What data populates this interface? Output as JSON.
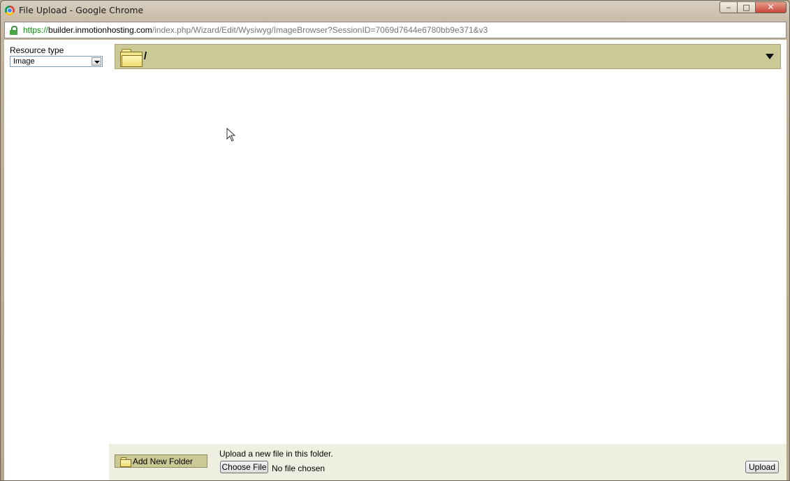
{
  "window": {
    "title": "File Upload - Google Chrome",
    "controls": {
      "minimize": "minimize-icon",
      "maximize": "maximize-icon",
      "close": "close-icon"
    }
  },
  "address": {
    "scheme": "https://",
    "host": "builder.inmotionhosting.com",
    "path": "/index.php/Wizard/Edit/Wysiwyg/ImageBrowser?SessionID=7069d7644e6780bb9e371&v3",
    "secure_icon": "lock-icon"
  },
  "sidebar": {
    "resource_type_label": "Resource type",
    "resource_type_value": "Image"
  },
  "folder_bar": {
    "path": "/",
    "icon": "folder-icon"
  },
  "bottom": {
    "add_folder_label": "Add New Folder",
    "upload_hint": "Upload a new file in this folder.",
    "choose_file_label": "Choose File",
    "no_file_text": "No file chosen",
    "upload_label": "Upload"
  },
  "colors": {
    "folder_bar_bg": "#cbc996",
    "bottom_bar_bg": "#efefe1",
    "secure_green": "#009900"
  }
}
